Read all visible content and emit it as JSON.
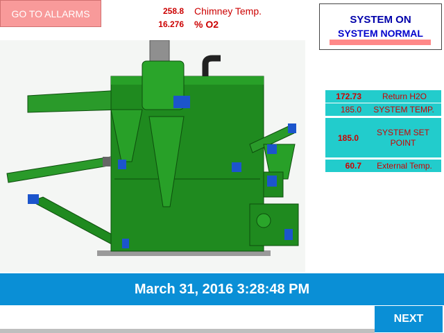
{
  "buttons": {
    "alarms": "GO TO ALLARMS",
    "next": "NEXT"
  },
  "readouts": {
    "chimney_value": "258.8",
    "chimney_label": "Chimney Temp.",
    "o2_value": "16.276",
    "o2_label": "% O2"
  },
  "status": {
    "line1": "SYSTEM ON",
    "line2": "SYSTEM NORMAL"
  },
  "panel": {
    "return_value": "172.73",
    "return_label": "Return H2O",
    "system_temp_value": "185.0",
    "system_temp_label": "SYSTEM TEMP.",
    "setpoint_value": "185.0",
    "setpoint_label": "SYSTEM SET POINT",
    "external_value": "60.7",
    "external_label": "External Temp."
  },
  "datetime": "March 31, 2016 3:28:48 PM",
  "colors": {
    "alarm_button": "#f89a9a",
    "accent_blue": "#0a8fd6",
    "panel_cyan": "#22cccc",
    "machine_green": "#1f8a1f",
    "value_red": "#cc0000"
  }
}
